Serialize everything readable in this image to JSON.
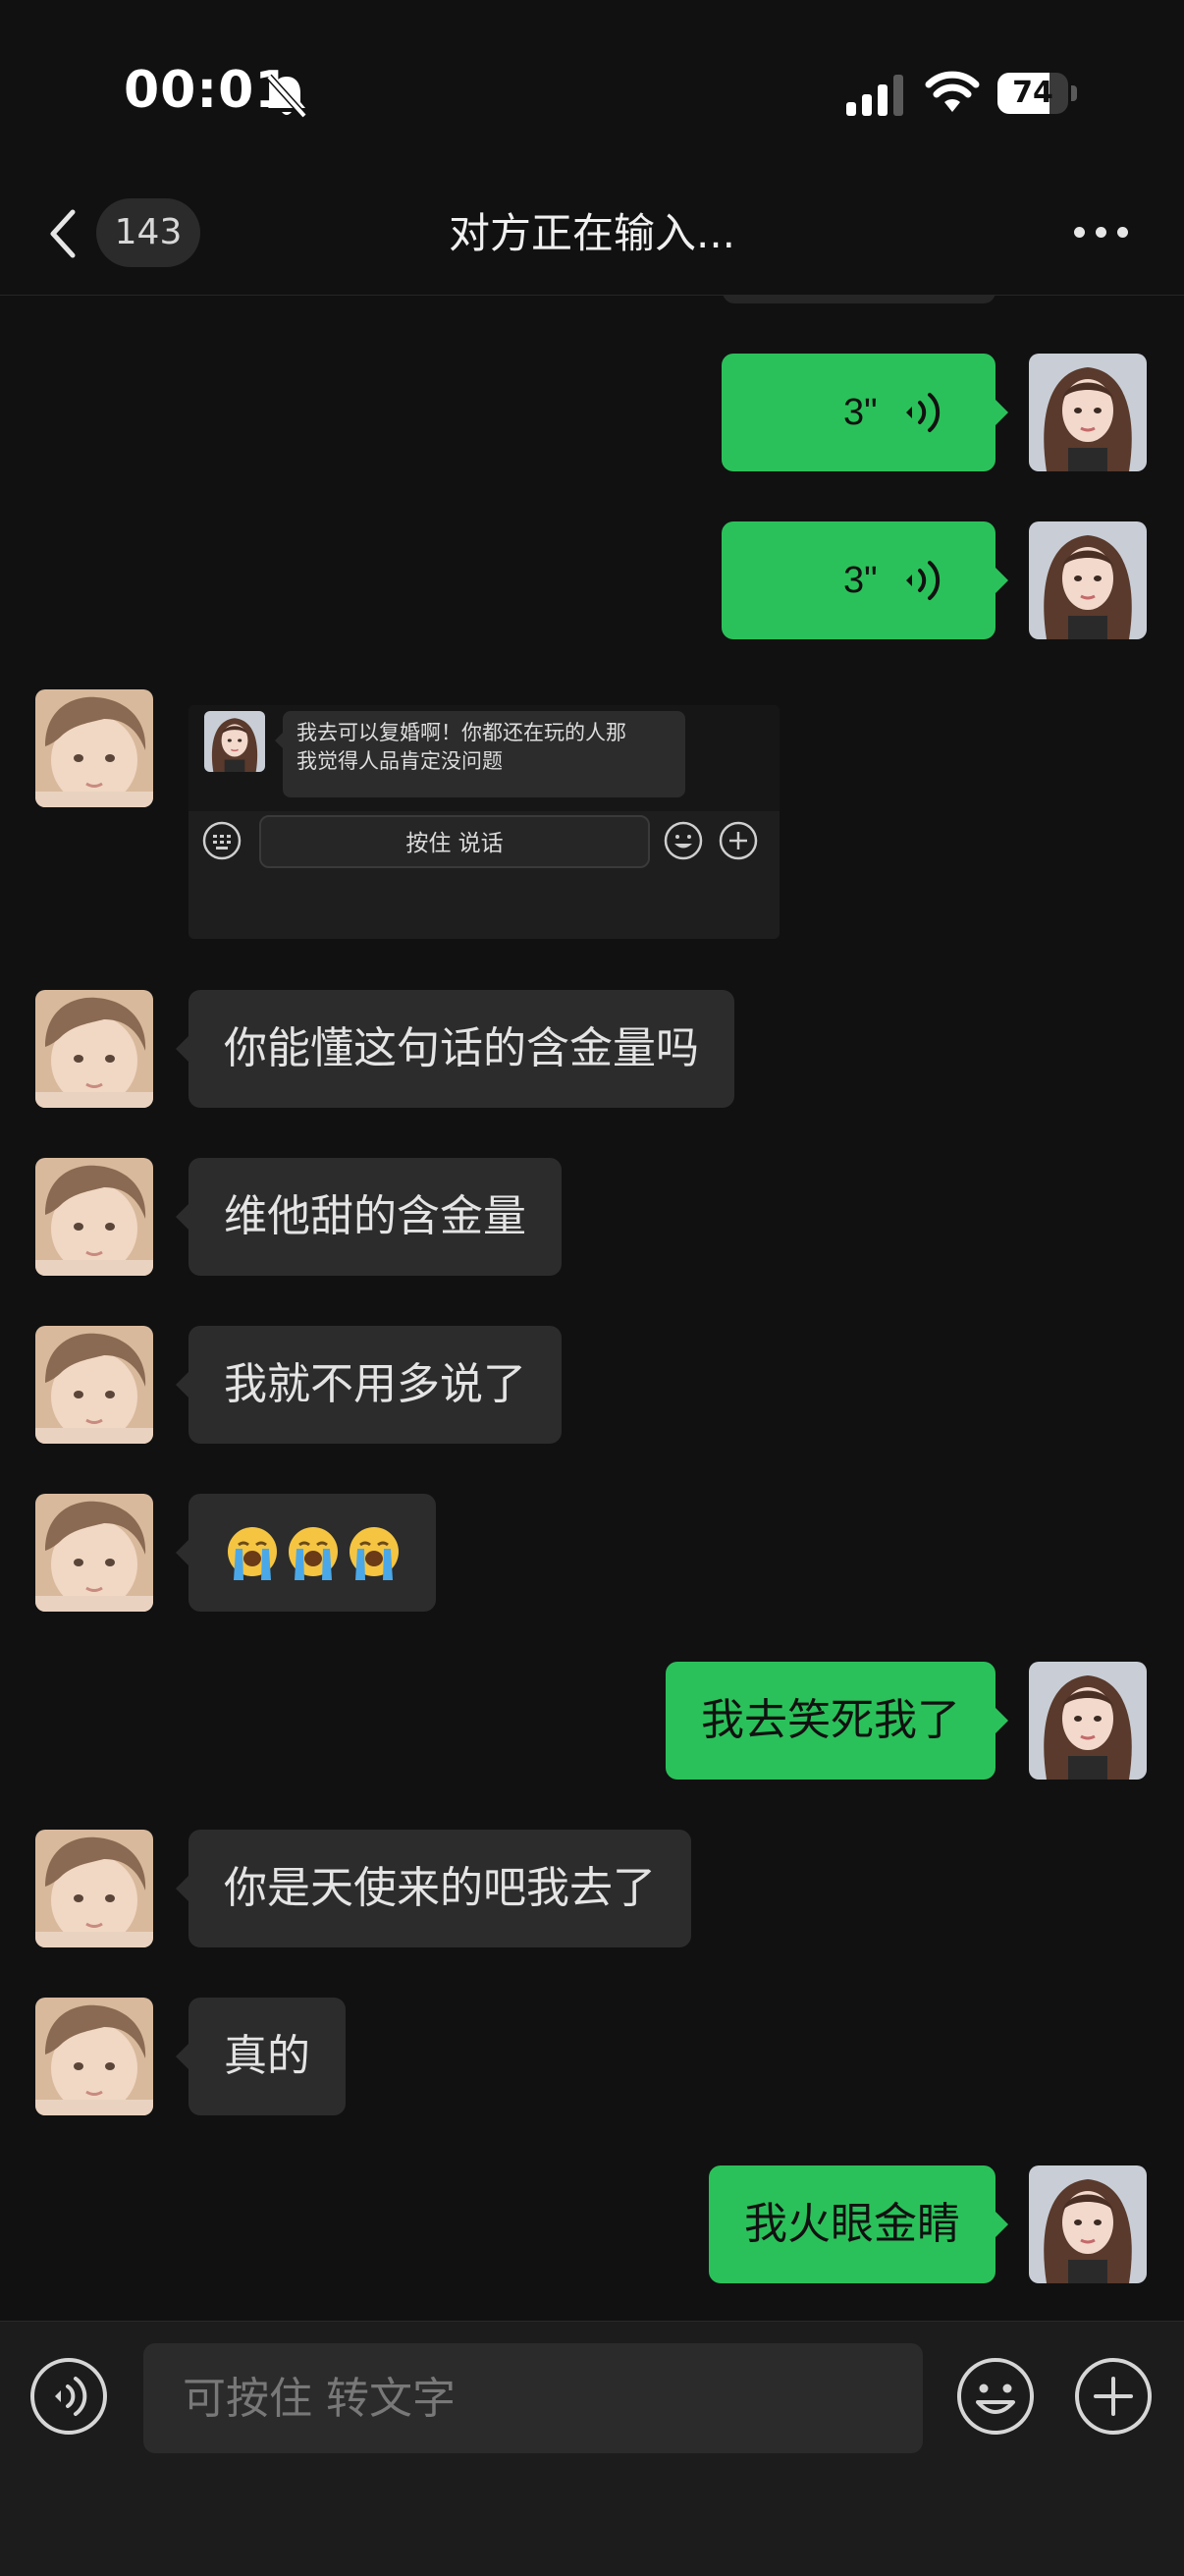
{
  "status_bar": {
    "time": "00:01",
    "battery_percent": "74",
    "battery_level": 0.74
  },
  "nav": {
    "unread_count": "143",
    "title": "对方正在输入..."
  },
  "messages": {
    "voice_1": {
      "duration": "3\""
    },
    "voice_2": {
      "duration": "3\""
    },
    "shared_image": {
      "quoted_line_1": "我去可以复婚啊！你都还在玩的人那",
      "quoted_line_2": "我觉得人品肯定没问题",
      "hold_to_talk": "按住 说话"
    },
    "m1": "你能懂这句话的含金量吗",
    "m2": "维他甜的含金量",
    "m3": "我就不用多说了",
    "m4_emoji_count": 3,
    "m5": "我去笑死我了",
    "m6": "你是天使来的吧我去了",
    "m7": "真的",
    "m8": "我火眼金睛"
  },
  "input_bar": {
    "placeholder": "可按住 转文字"
  },
  "colors": {
    "background": "#111111",
    "incoming_bubble": "#2c2c2c",
    "outgoing_bubble": "#2bc15a",
    "input_bar": "#1c1c1c"
  },
  "icons": [
    "silent-bell-icon",
    "signal-icon",
    "wifi-icon",
    "battery-icon",
    "back-chevron-icon",
    "more-icon",
    "voice-wave-icon",
    "crying-emoji-icon",
    "voice-mode-icon",
    "emoji-face-icon",
    "plus-icon",
    "keyboard-icon"
  ]
}
